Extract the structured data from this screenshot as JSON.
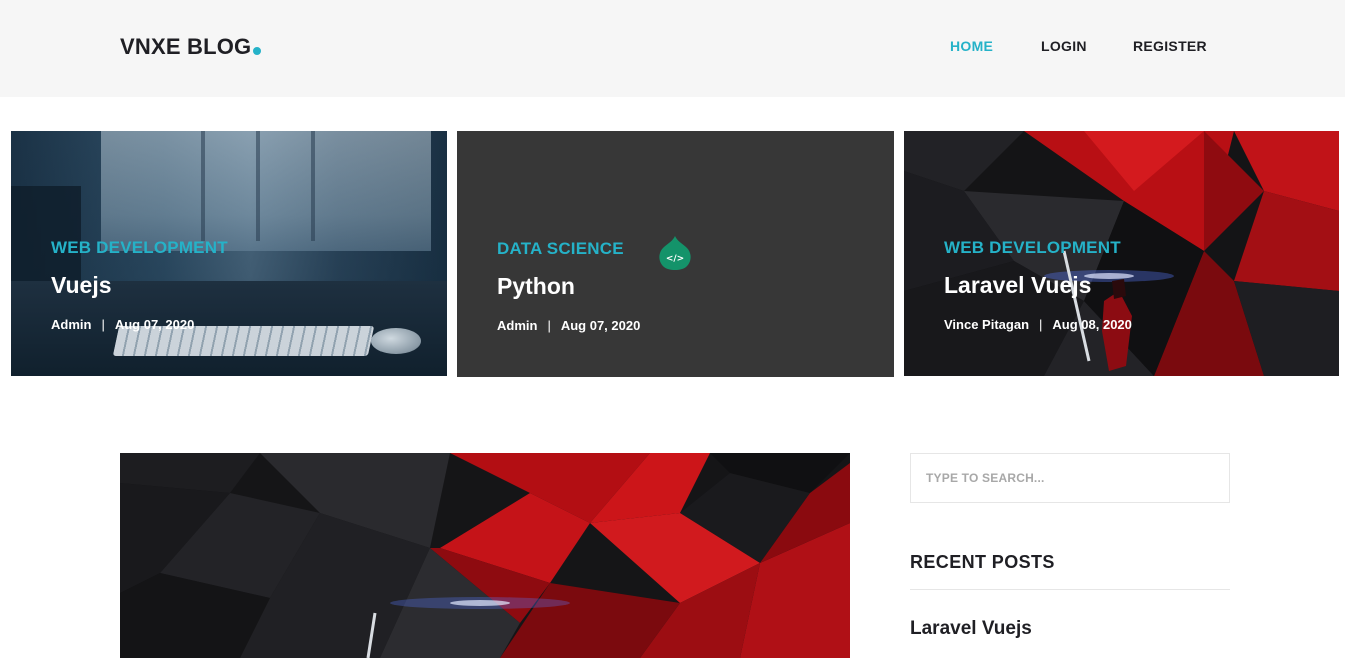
{
  "header": {
    "logo": "VNXE BLOG",
    "nav": [
      {
        "label": "HOME",
        "active": true
      },
      {
        "label": "LOGIN",
        "active": false
      },
      {
        "label": "REGISTER",
        "active": false
      }
    ]
  },
  "featured": [
    {
      "category": "WEB DEVELOPMENT",
      "title": "Vuejs",
      "author": "Admin",
      "date": "Aug 07, 2020"
    },
    {
      "category": "DATA SCIENCE",
      "title": "Python",
      "author": "Admin",
      "date": "Aug 07, 2020",
      "icon": "code-drop-icon"
    },
    {
      "category": "WEB DEVELOPMENT",
      "title": "Laravel Vuejs",
      "author": "Vince Pitagan",
      "date": "Aug 08, 2020"
    }
  ],
  "sidebar": {
    "search_placeholder": "TYPE TO SEARCH...",
    "recent_heading": "RECENT POSTS",
    "recent_posts": [
      "Laravel Vuejs"
    ]
  },
  "colors": {
    "accent": "#25b2c8",
    "header_bg": "#f6f6f6",
    "card_dark": "#373737",
    "icon_green": "#14936a"
  }
}
